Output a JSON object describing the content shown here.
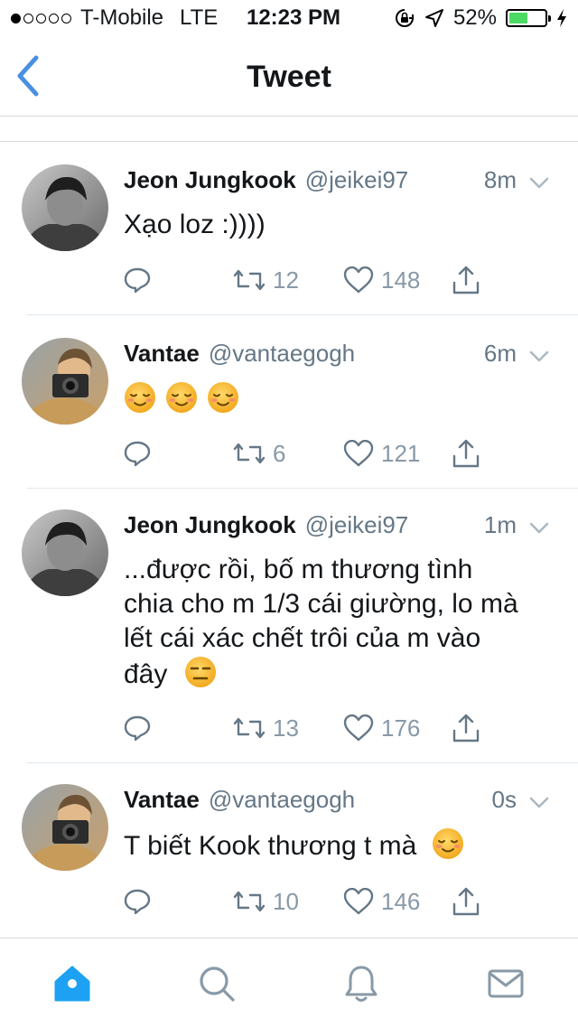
{
  "status_bar": {
    "signal_dots_filled": 1,
    "signal_dots_total": 5,
    "carrier": "T-Mobile",
    "network": "LTE",
    "time": "12:23 PM",
    "battery": "52%",
    "battery_level": 0.52,
    "icons": [
      "orientation-lock-icon",
      "location-arrow-icon",
      "battery-icon",
      "charging-bolt-icon"
    ]
  },
  "nav": {
    "title": "Tweet",
    "back_icon": "chevron-left-icon",
    "accent": "#4a90e2"
  },
  "tweets": [
    {
      "name": "Jeon Jungkook",
      "handle": "@jeikei97",
      "time": "8m",
      "text": "Xạo loz :))))",
      "emojis": 0,
      "retweets": "12",
      "likes": "148",
      "avatar": "avatar-grayscale"
    },
    {
      "name": "Vantae",
      "handle": "@vantaegogh",
      "time": "6m",
      "text": "",
      "emojis": 3,
      "retweets": "6",
      "likes": "121",
      "avatar": "avatar-camera"
    },
    {
      "name": "Jeon Jungkook",
      "handle": "@jeikei97",
      "time": "1m",
      "text_lines": [
        "...được rồi, bố m thương tình",
        "chia cho m 1/3 cái giường, lo mà",
        "lết cái xác chết trôi của m vào",
        "đây"
      ],
      "emojis": 1,
      "emoji_type": "expressionless",
      "retweets": "13",
      "likes": "176",
      "avatar": "avatar-grayscale"
    },
    {
      "name": "Vantae",
      "handle": "@vantaegogh",
      "time": "0s",
      "text": "T biết Kook thương t mà",
      "emojis": 1,
      "emoji_type": "relieved",
      "retweets": "10",
      "likes": "146",
      "avatar": "avatar-camera"
    }
  ],
  "tabbar": {
    "items": [
      "home-icon",
      "search-icon",
      "notifications-icon",
      "messages-icon"
    ],
    "active": "home-icon",
    "active_color": "#1da1f2",
    "inactive_color": "#8899a6"
  }
}
